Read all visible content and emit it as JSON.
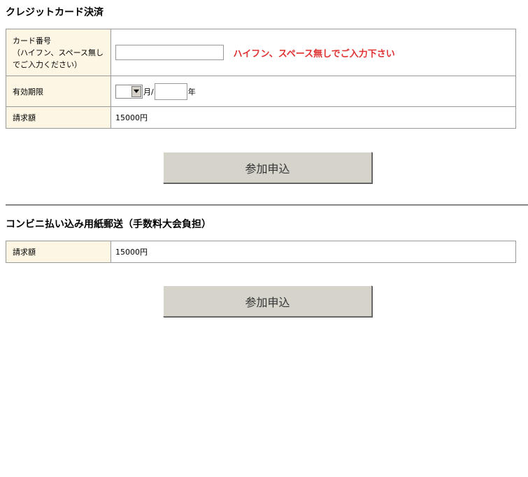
{
  "credit": {
    "title": "クレジットカード決済",
    "card_label_lines": [
      "カード番号",
      "（ハイフン、スペース無し",
      "でご入力ください）"
    ],
    "card_value": "",
    "card_note": "ハイフン、スペース無しでご入力下さい",
    "expiry_label": "有効期限",
    "month_selected": "",
    "month_unit": "月/",
    "year_value": "",
    "year_unit": "年",
    "amount_label": "請求額",
    "amount_value": "15000円",
    "submit_label": "参加申込"
  },
  "convenience": {
    "title": "コンビニ払い込み用紙郵送（手数料大会負担）",
    "amount_label": "請求額",
    "amount_value": "15000円",
    "submit_label": "参加申込"
  },
  "colors": {
    "label_bg": "#fdf6e4",
    "note_red": "#e03030",
    "button_bg": "#d6d3cb"
  }
}
